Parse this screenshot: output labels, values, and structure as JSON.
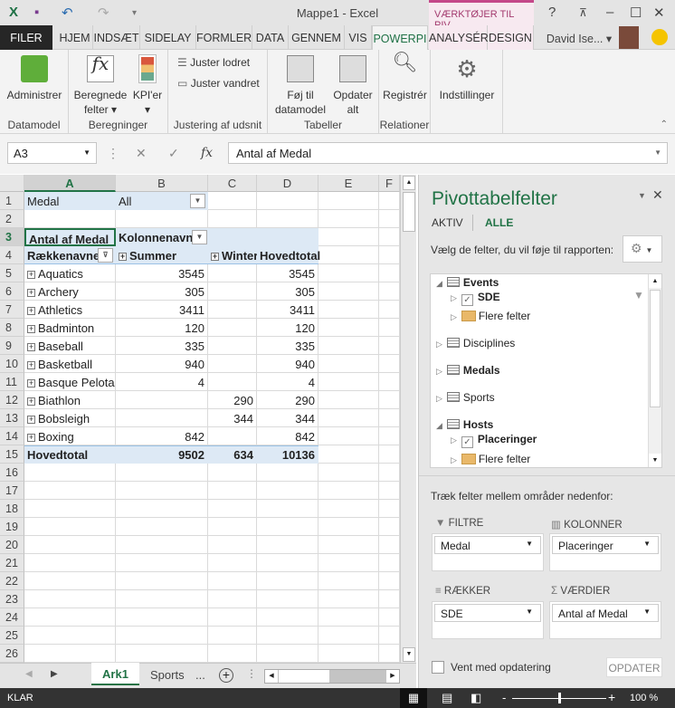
{
  "window": {
    "title": "Mappe1 - Excel",
    "contextual_header": "VÆRKTØJER TIL PIV...",
    "user": "David Ise...",
    "help": "?"
  },
  "tabs": [
    "FILER",
    "HJEM",
    "INDSÆT",
    "SIDELAY",
    "FORMLER",
    "DATA",
    "GENNEM",
    "VIS",
    "POWERPI",
    "ANALYSÉR",
    "DESIGN"
  ],
  "active_tab": "POWERPI",
  "ribbon": {
    "administrer": "Administrer",
    "beregnede": "Beregnede",
    "felter": "felter",
    "kpi": "KPI'er",
    "juster_lodret": "Juster lodret",
    "juster_vandret": "Juster vandret",
    "foj_til": "Føj til",
    "datamodel_btn": "datamodel",
    "opdater": "Opdater",
    "alt": "alt",
    "registrer": "Registrér",
    "indstillinger": "Indstillinger",
    "groups": [
      "Datamodel",
      "Beregninger",
      "Justering af udsnit",
      "Tabeller",
      "Relationer"
    ]
  },
  "formula_bar": {
    "name_box": "A3",
    "fx": "fx",
    "value": "Antal af Medal"
  },
  "grid": {
    "columns": [
      "A",
      "B",
      "C",
      "D",
      "E",
      "F"
    ],
    "row_count": 26,
    "filter": {
      "label": "Medal",
      "value": "All"
    },
    "value_header": "Antal af Medal",
    "col_labels": "Kolonnenavne",
    "row_labels": "Rækkenavne",
    "col_items": [
      "Summer",
      "Winter"
    ],
    "grand_total_header": "Hovedtotal",
    "rows": [
      {
        "label": "Aquatics",
        "summer": "3545",
        "winter": "",
        "total": "3545"
      },
      {
        "label": "Archery",
        "summer": "305",
        "winter": "",
        "total": "305"
      },
      {
        "label": "Athletics",
        "summer": "3411",
        "winter": "",
        "total": "3411"
      },
      {
        "label": "Badminton",
        "summer": "120",
        "winter": "",
        "total": "120"
      },
      {
        "label": "Baseball",
        "summer": "335",
        "winter": "",
        "total": "335"
      },
      {
        "label": "Basketball",
        "summer": "940",
        "winter": "",
        "total": "940"
      },
      {
        "label": "Basque Pelota",
        "summer": "4",
        "winter": "",
        "total": "4"
      },
      {
        "label": "Biathlon",
        "summer": "",
        "winter": "290",
        "total": "290"
      },
      {
        "label": "Bobsleigh",
        "summer": "",
        "winter": "344",
        "total": "344"
      },
      {
        "label": "Boxing",
        "summer": "842",
        "winter": "",
        "total": "842"
      }
    ],
    "grand_total": {
      "label": "Hovedtotal",
      "summer": "9502",
      "winter": "634",
      "total": "10136"
    }
  },
  "sheets": {
    "tabs": [
      "Ark1",
      "Sports"
    ],
    "active": "Ark1",
    "more": "..."
  },
  "status": {
    "ready": "KLAR",
    "zoom": "100 %",
    "zoom_level": 100
  },
  "pane": {
    "title": "Pivottabelfelter",
    "tab_aktiv": "AKTIV",
    "tab_alle": "ALLE",
    "prompt": "Vælg de felter, du vil føje til rapporten:",
    "fields": {
      "events": "Events",
      "sde": "SDE",
      "flere1": "Flere felter",
      "disciplines": "Disciplines",
      "medals": "Medals",
      "sports": "Sports",
      "hosts": "Hosts",
      "placeringer": "Placeringer",
      "flere2": "Flere felter"
    },
    "drag_hint": "Træk felter mellem områder nedenfor:",
    "areas": {
      "filtre": {
        "label": "FILTRE",
        "item": "Medal"
      },
      "kolonner": {
        "label": "KOLONNER",
        "item": "Placeringer"
      },
      "raekker": {
        "label": "RÆKKER",
        "item": "SDE"
      },
      "vaerdier": {
        "label": "VÆRDIER",
        "item": "Antal af Medal"
      }
    },
    "defer": "Vent med opdatering",
    "update": "OPDATER"
  }
}
